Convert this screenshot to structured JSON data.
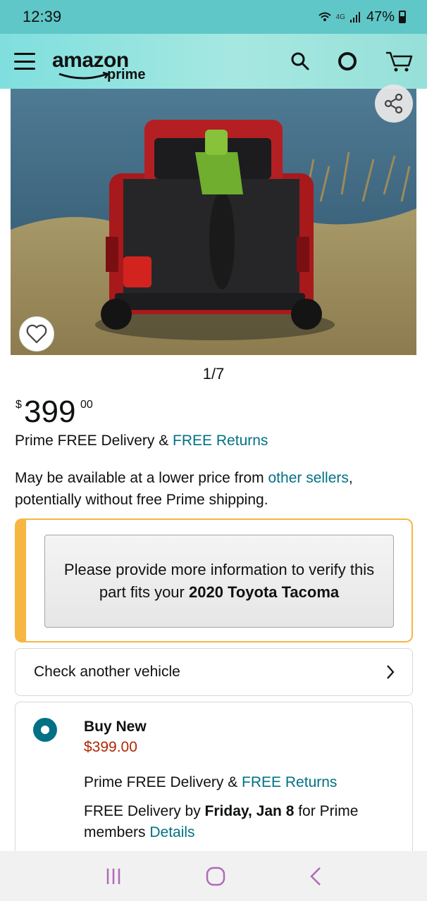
{
  "status_bar": {
    "time": "12:39",
    "network": "4G",
    "battery": "47%"
  },
  "header": {
    "logo_primary": "amazon",
    "logo_secondary": "prime"
  },
  "gallery": {
    "counter": "1/7"
  },
  "price": {
    "symbol": "$",
    "whole": "399",
    "fraction": "00"
  },
  "delivery": {
    "prefix": "Prime FREE Delivery & ",
    "returns_link": "FREE Returns"
  },
  "availability": {
    "text_before": "May be available at a lower price from ",
    "link": "other sellers",
    "text_after": ",",
    "second_line": "potentially without free Prime shipping."
  },
  "fitment": {
    "text_before": "Please provide more information to verify this part fits your ",
    "vehicle": "2020 Toyota Tacoma"
  },
  "check_vehicle": {
    "label": "Check another vehicle"
  },
  "buy_new": {
    "title": "Buy New",
    "price": "$399.00",
    "delivery_prefix": "Prime FREE Delivery & ",
    "returns_link": "FREE Returns",
    "free_delivery_prefix": "FREE Delivery by ",
    "free_delivery_date": "Friday, Jan 8",
    "free_delivery_suffix": " for Prime",
    "members_text": "members ",
    "details_link": "Details"
  },
  "colors": {
    "accent_link": "#007185",
    "price_red": "#b12704",
    "warning_border": "#f7b642",
    "header_teal": "#7fdfde"
  },
  "icons": {
    "menu": "hamburger-icon",
    "search": "search-icon",
    "alexa": "alexa-icon",
    "cart": "cart-icon",
    "share": "share-icon",
    "wishlist": "heart-icon",
    "chevron": "chevron-right-icon"
  }
}
